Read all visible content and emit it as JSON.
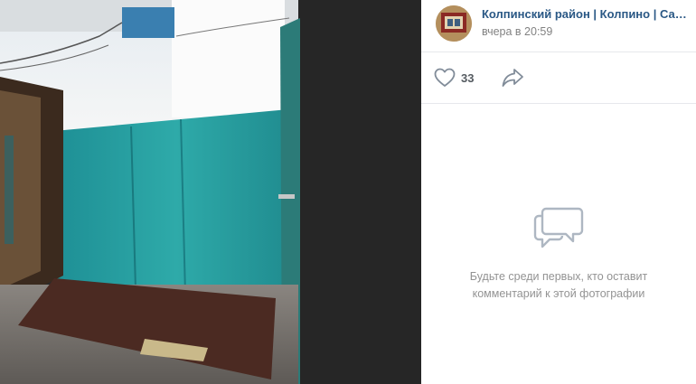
{
  "post": {
    "author": "Колпинский район | Колпино | Сан...",
    "time": "вчера в 20:59"
  },
  "actions": {
    "likes_count": "33",
    "like_icon": "heart-icon",
    "share_icon": "share-arrow-icon"
  },
  "comments": {
    "empty_icon": "comment-bubbles-icon",
    "empty_line1": "Будьте среди первых, кто оставит",
    "empty_line2": "комментарий к этой фотографии"
  },
  "colors": {
    "link": "#2a5885",
    "muted": "#939393",
    "icon": "#818c99"
  }
}
